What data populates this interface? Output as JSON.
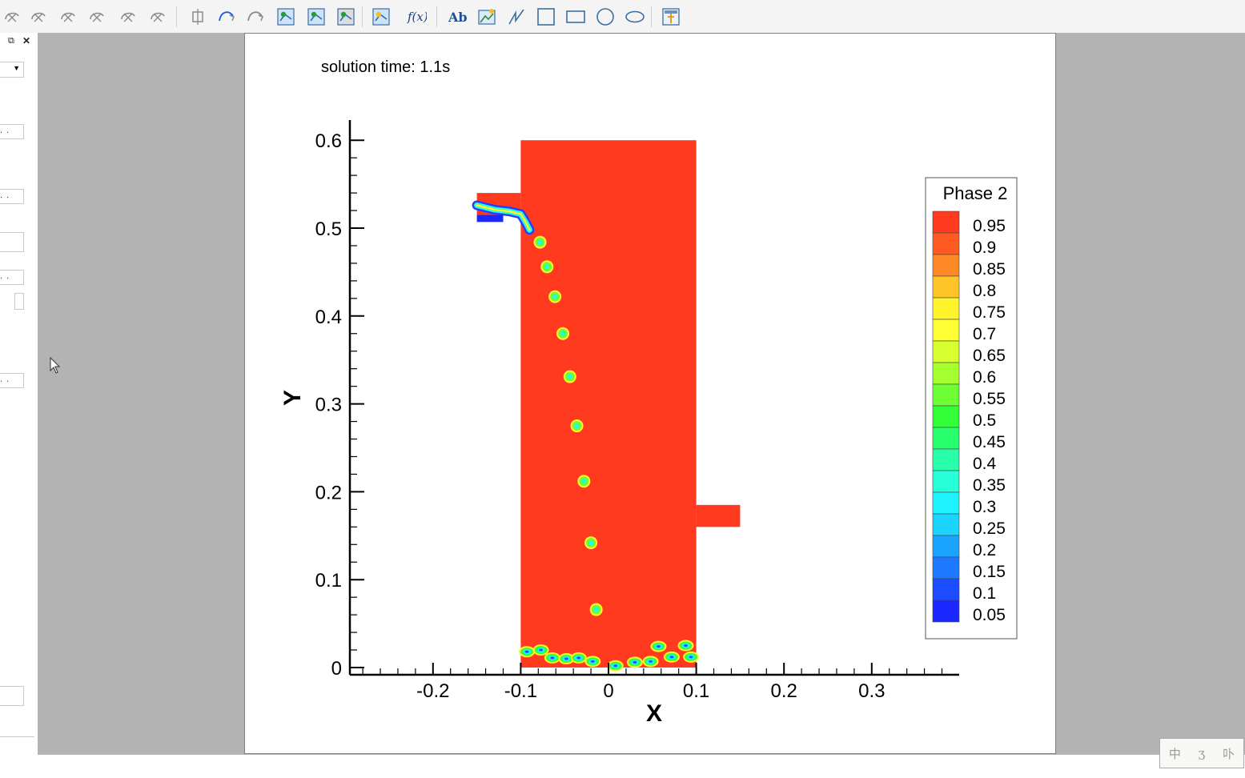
{
  "toolbar": {
    "icons": [
      "rotate-x-icon",
      "rotate-y-icon",
      "rotate-z-icon",
      "rotate-xy-icon",
      "rotate-yz-icon",
      "rotate-xz-icon",
      "probe-icon",
      "adjust-curve-icon",
      "translate-icon",
      "add-zone-icon",
      "slice-icon",
      "contour-edit-icon",
      "data-edit-icon",
      "function-icon",
      "text-tool-icon",
      "image-tool-icon",
      "polyline-tool-icon",
      "square-tool-icon",
      "rectangle-tool-icon",
      "circle-tool-icon",
      "ellipse-tool-icon",
      "frame-tool-icon"
    ],
    "function_label": "f(x)",
    "text_label": "Ab"
  },
  "left_panel": {
    "dock_icon": "⧉",
    "close_icon": "✕",
    "field_dots": ". ."
  },
  "plot": {
    "solution_time_label": "solution time: 1.1s",
    "colors": {
      "fluid": "#ff3a1f",
      "axis": "#000000",
      "frame_border": "#808080",
      "workspace": "#b3b3b3"
    }
  },
  "chart_data": {
    "type": "heatmap",
    "title": "",
    "xlabel": "X",
    "ylabel": "Y",
    "xlim": [
      -0.29,
      0.4
    ],
    "ylim": [
      -0.01,
      0.62
    ],
    "x_ticks": [
      -0.2,
      -0.1,
      0,
      0.1,
      0.2,
      0.3
    ],
    "x_tick_labels": [
      "-0.2",
      "-0.1",
      "0",
      "0.1",
      "0.2",
      "0.3"
    ],
    "y_ticks": [
      0,
      0.1,
      0.2,
      0.3,
      0.4,
      0.5,
      0.6
    ],
    "y_tick_labels": [
      "0",
      "0.1",
      "0.2",
      "0.3",
      "0.4",
      "0.5",
      "0.6"
    ],
    "domain": {
      "column": {
        "x": [
          -0.1,
          0.1
        ],
        "y": [
          0,
          0.6
        ]
      },
      "inlet": {
        "x": [
          -0.15,
          -0.1
        ],
        "y": [
          0.515,
          0.54
        ]
      },
      "outlet": {
        "x": [
          0.1,
          0.15
        ],
        "y": [
          0.16,
          0.185
        ]
      }
    },
    "background_value": 0.95,
    "inlet_jet": [
      [
        -0.15,
        0.526
      ],
      [
        -0.13,
        0.521
      ],
      [
        -0.113,
        0.519
      ],
      [
        -0.1,
        0.516
      ],
      [
        -0.094,
        0.506
      ],
      [
        -0.09,
        0.498
      ]
    ],
    "bubbles": [
      {
        "x": -0.078,
        "y": 0.484
      },
      {
        "x": -0.07,
        "y": 0.456
      },
      {
        "x": -0.061,
        "y": 0.422
      },
      {
        "x": -0.052,
        "y": 0.38
      },
      {
        "x": -0.044,
        "y": 0.331
      },
      {
        "x": -0.036,
        "y": 0.275
      },
      {
        "x": -0.028,
        "y": 0.212
      },
      {
        "x": -0.02,
        "y": 0.142
      },
      {
        "x": -0.014,
        "y": 0.066
      }
    ],
    "bottom_bubbles": [
      {
        "x": -0.093,
        "y": 0.018
      },
      {
        "x": -0.077,
        "y": 0.02
      },
      {
        "x": -0.064,
        "y": 0.011
      },
      {
        "x": -0.048,
        "y": 0.01
      },
      {
        "x": -0.034,
        "y": 0.011
      },
      {
        "x": -0.018,
        "y": 0.007
      },
      {
        "x": 0.008,
        "y": 0.002
      },
      {
        "x": 0.03,
        "y": 0.006
      },
      {
        "x": 0.048,
        "y": 0.007
      },
      {
        "x": 0.057,
        "y": 0.024
      },
      {
        "x": 0.072,
        "y": 0.012
      },
      {
        "x": 0.088,
        "y": 0.025
      },
      {
        "x": 0.094,
        "y": 0.012
      }
    ],
    "legend": {
      "title": "Phase 2",
      "levels": [
        "0.95",
        "0.9",
        "0.85",
        "0.8",
        "0.75",
        "0.7",
        "0.65",
        "0.6",
        "0.55",
        "0.5",
        "0.45",
        "0.4",
        "0.35",
        "0.3",
        "0.25",
        "0.2",
        "0.15",
        "0.1",
        "0.05"
      ],
      "colors": [
        "#ff3a1f",
        "#ff5a22",
        "#ff8a25",
        "#ffc528",
        "#fff32b",
        "#ffff33",
        "#d8ff2e",
        "#a6ff2f",
        "#6dff33",
        "#33ff39",
        "#27ff6c",
        "#29ffaa",
        "#27ffd9",
        "#1ef3ff",
        "#1bd4ff",
        "#1ba4ff",
        "#1c78ff",
        "#1b4cff",
        "#1a27ff"
      ],
      "position": "right"
    }
  }
}
